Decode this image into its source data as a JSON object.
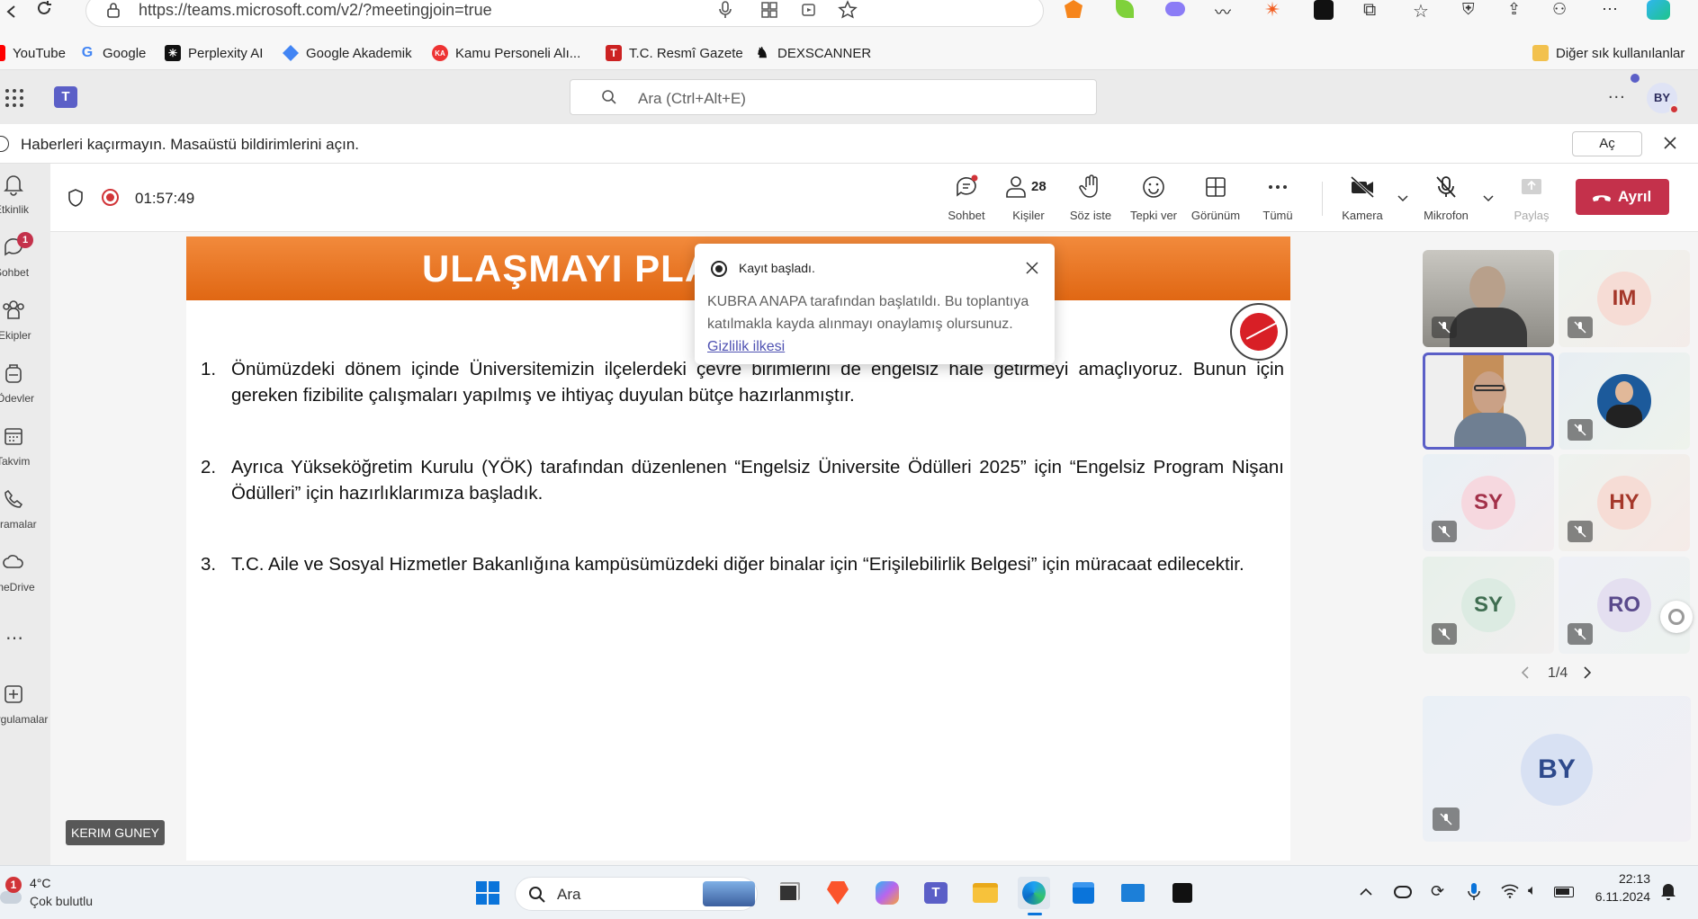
{
  "browser": {
    "url": "https://teams.microsoft.com/v2/?meetingjoin=true",
    "bookmarks": [
      {
        "label": "YouTube"
      },
      {
        "label": "Google"
      },
      {
        "label": "Perplexity AI"
      },
      {
        "label": "Google Akademik"
      },
      {
        "label": "Kamu Personeli Alı..."
      },
      {
        "label": "T.C. Resmî Gazete"
      },
      {
        "label": "DEXSCANNER"
      }
    ],
    "other_bookmarks": "Diğer sık kullanılanlar"
  },
  "teams": {
    "search_placeholder": "Ara (Ctrl+Alt+E)",
    "more": "...",
    "user_initials": "BY",
    "notification": {
      "text": "Haberleri kaçırmayın. Masaüstü bildirimlerini açın.",
      "action": "Aç"
    }
  },
  "rail": [
    {
      "label": "Etkinlik",
      "icon": "bell-icon"
    },
    {
      "label": "Sohbet",
      "icon": "chat-icon",
      "badge": "1"
    },
    {
      "label": "Ekipler",
      "icon": "teams-icon"
    },
    {
      "label": "Ödevler",
      "icon": "backpack-icon"
    },
    {
      "label": "Takvim",
      "icon": "calendar-icon"
    },
    {
      "label": "Aramalar",
      "icon": "phone-icon"
    },
    {
      "label": "OneDrive",
      "icon": "cloud-icon"
    },
    {
      "label": "Uygulamalar",
      "icon": "plus-icon"
    }
  ],
  "meeting": {
    "timer": "01:57:49",
    "tools": {
      "chat": "Sohbet",
      "people": "Kişiler",
      "people_count": "28",
      "raise": "Söz iste",
      "react": "Tepki ver",
      "view": "Görünüm",
      "more": "Tümü",
      "camera": "Kamera",
      "mic": "Mikrofon",
      "share": "Paylaş"
    },
    "leave": "Ayrıl"
  },
  "slide": {
    "title": "ULAŞMAYI PLA",
    "items": [
      {
        "num": "1.",
        "text": "Önümüzdeki dönem içinde Üniversitemizin ilçelerdeki çevre birimlerini de engelsiz hale getirmeyi amaçlıyoruz. Bunun için gereken fizibilite çalışmaları yapılmış ve ihtiyaç duyulan bütçe hazırlanmıştır."
      },
      {
        "num": "2.",
        "text": "Ayrıca Yükseköğretim Kurulu (YÖK) tarafından düzenlenen “Engelsiz Üniversite Ödülleri 2025” için “Engelsiz Program Nişanı Ödülleri” için hazırlıklarımıza başladık."
      },
      {
        "num": "3.",
        "text": "T.C. Aile ve Sosyal Hizmetler Bakanlığına  kampüsümüzdeki diğer binalar için “Erişilebilirlik Belgesi”  için müracaat edilecektir."
      }
    ],
    "presenter": "KERIM GUNEY"
  },
  "toast": {
    "title": "Kayıt başladı.",
    "body": "KUBRA ANAPA tarafından başlatıldı. Bu toplantıya katılmakla kayda alınmayı onaylamış olursunuz.",
    "link": "Gizlilik ilkesi"
  },
  "participants": [
    {
      "initials": "",
      "type": "video"
    },
    {
      "initials": "IM",
      "bg": "#f6dcd5",
      "fg": "#a5372a"
    },
    {
      "initials": "",
      "type": "video-active"
    },
    {
      "initials": "",
      "type": "photo"
    },
    {
      "initials": "SY",
      "bg": "#f6d8df",
      "fg": "#a33149"
    },
    {
      "initials": "HY",
      "bg": "#f6dcd5",
      "fg": "#a5372a"
    },
    {
      "initials": "SY",
      "bg": "#dcebe2",
      "fg": "#3f6e51"
    },
    {
      "initials": "RO",
      "bg": "#e4dff0",
      "fg": "#5a4a8c"
    }
  ],
  "pager": "1/4",
  "self_tile": {
    "initials": "BY"
  },
  "taskbar": {
    "weather_temp": "4°C",
    "weather_desc": "Çok bulutlu",
    "weather_badge": "1",
    "search": "Ara",
    "time": "22:13",
    "date": "6.11.2024"
  },
  "colors": {
    "accent": "#5b5fc7",
    "leave": "#c4314b",
    "record": "#d13438",
    "slide_band": "#e8731f"
  }
}
